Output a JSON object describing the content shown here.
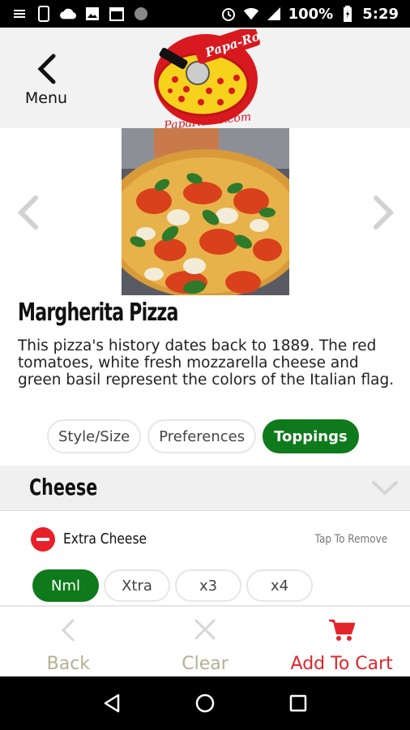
{
  "status_bar": {
    "battery": "100%",
    "time": "5:29"
  },
  "header": {
    "menu_label": "Menu",
    "logo_text_top": "Papa-Roni's",
    "logo_text_bottom": "PapaRonis.com"
  },
  "product": {
    "title": "Margherita Pizza",
    "description": "This pizza's history dates back to 1889. The red tomatoes, white fresh mozzarella cheese and green basil represent the colors of the Italian flag."
  },
  "tabs": [
    {
      "label": "Style/Size",
      "active": false
    },
    {
      "label": "Preferences",
      "active": false
    },
    {
      "label": "Toppings",
      "active": true
    }
  ],
  "section": {
    "title": "Cheese",
    "option": {
      "label": "Extra Cheese",
      "hint": "Tap To Remove"
    },
    "quantities": [
      "Nml",
      "Xtra",
      "x3",
      "x4"
    ]
  },
  "bottom_bar": {
    "back_label": "Back",
    "clear_label": "Clear",
    "cart_label": "Add To Cart"
  },
  "colors": {
    "accent_green": "#0f7a1b",
    "accent_red": "#e4232b",
    "muted_label": "#b4b092"
  },
  "icons": {
    "back": "chevron-left-icon",
    "clear": "close-icon",
    "cart": "cart-icon",
    "remove": "minus-circle-icon"
  }
}
